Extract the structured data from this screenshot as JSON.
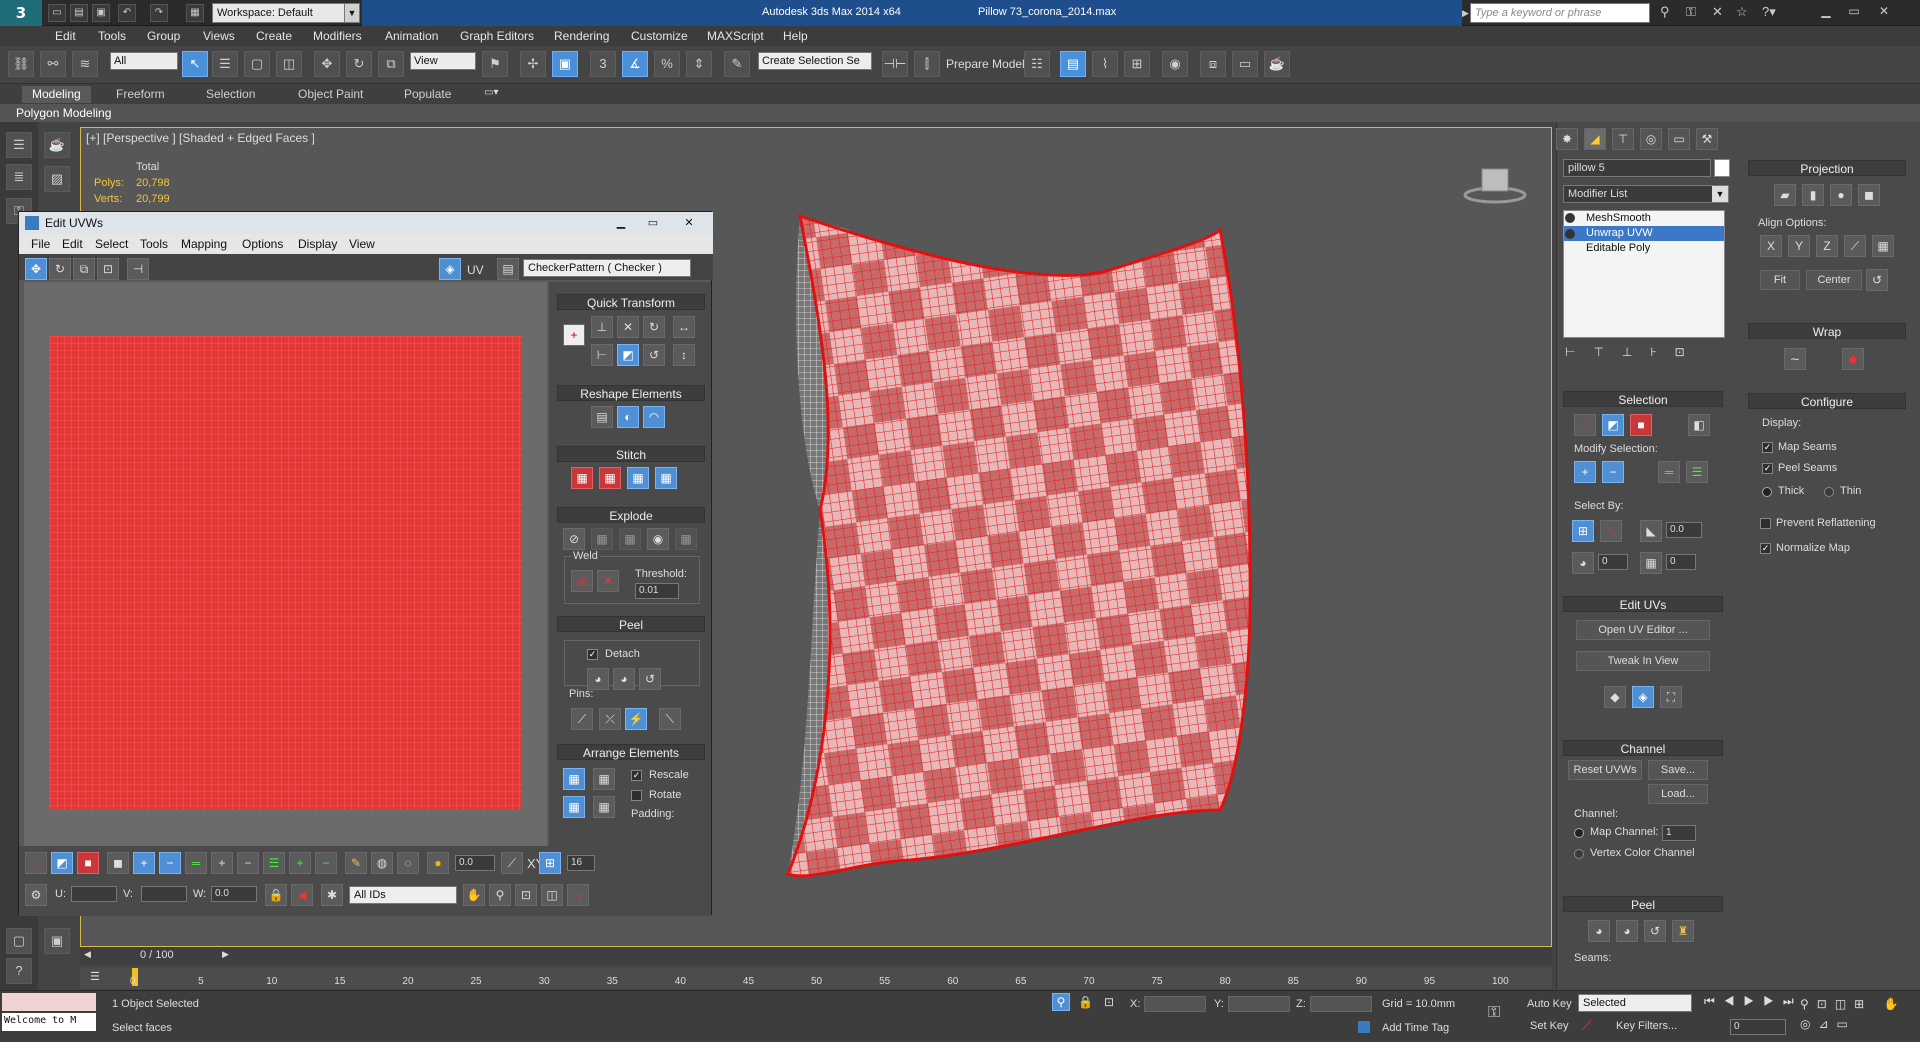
{
  "titlebar": {
    "workspace": "Workspace: Default",
    "app_title": "Autodesk 3ds Max  2014 x64",
    "file_title": "Pillow 73_corona_2014.max",
    "search_placeholder": "Type a keyword or phrase",
    "quick_access": [
      "new-icon",
      "open-icon",
      "save-icon",
      "undo-icon",
      "redo-icon",
      "project-folder-icon"
    ]
  },
  "menu": [
    "Edit",
    "Tools",
    "Group",
    "Views",
    "Create",
    "Modifiers",
    "Animation",
    "Graph Editors",
    "Rendering",
    "Customize",
    "MAXScript",
    "Help"
  ],
  "toolbar": {
    "selection_filter": "All",
    "ref_coord": "View",
    "named_selection": "Create Selection Se",
    "prepare_model": "Prepare Model",
    "snap_labels": {
      "snap3": "3",
      "angle": "",
      "percent": "%"
    }
  },
  "ribbon": {
    "tabs": [
      "Modeling",
      "Freeform",
      "Selection",
      "Object Paint",
      "Populate"
    ],
    "active_tab": "Modeling",
    "sub_label": "Polygon Modeling"
  },
  "viewport": {
    "label": "[+] [Perspective ] [Shaded + Edged Faces ]",
    "stats": {
      "total_label": "Total",
      "polys_label": "Polys:",
      "polys": "20,798",
      "verts_label": "Verts:",
      "verts": "20,799"
    }
  },
  "uvw_editor": {
    "title": "Edit UVWs",
    "menu": [
      "File",
      "Edit",
      "Select",
      "Tools",
      "Mapping",
      "Options",
      "Display",
      "View"
    ],
    "uv_label": "UV",
    "checker_select": "CheckerPattern  ( Checker )",
    "rollouts": {
      "quick_transform": "Quick Transform",
      "reshape": "Reshape Elements",
      "stitch": "Stitch",
      "explode": "Explode",
      "weld": "Weld",
      "threshold_label": "Threshold:",
      "threshold": "0.01",
      "peel": "Peel",
      "detach": "Detach",
      "pins": "Pins:",
      "arrange": "Arrange Elements",
      "rescale": "Rescale",
      "rotate": "Rotate",
      "padding": "Padding:"
    },
    "bottom": {
      "value_00": "0.0",
      "value_16": "16",
      "xy_label": "XY",
      "u_label": "U:",
      "v_label": "V:",
      "w_label": "W:",
      "w_value": "0.0",
      "ids_select": "All IDs"
    }
  },
  "command_panel": {
    "object_name": "pillow 5",
    "modifier_list": "Modifier List",
    "stack": [
      "MeshSmooth",
      "Unwrap UVW",
      "Editable Poly"
    ],
    "selected_index": 1,
    "selection": {
      "title": "Selection",
      "modify_selection": "Modify Selection:",
      "select_by": "Select By:",
      "angle": "0.0",
      "v1": "0",
      "v2": "0"
    },
    "edit_uvs": {
      "title": "Edit UVs",
      "open_editor": "Open UV Editor ...",
      "tweak": "Tweak In View"
    },
    "channel": {
      "title": "Channel",
      "reset": "Reset UVWs",
      "save": "Save...",
      "load": "Load...",
      "label": "Channel:",
      "map_channel": "Map Channel:",
      "map_value": "1",
      "vertex_color": "Vertex Color Channel"
    },
    "peel": {
      "title": "Peel",
      "seams": "Seams:"
    },
    "projection": {
      "title": "Projection",
      "align_options": "Align Options:",
      "x": "X",
      "y": "Y",
      "z": "Z",
      "fit": "Fit",
      "center": "Center"
    },
    "wrap": {
      "title": "Wrap"
    },
    "configure": {
      "title": "Configure",
      "display": "Display:",
      "map_seams": "Map Seams",
      "peel_seams": "Peel Seams",
      "thick": "Thick",
      "thin": "Thin",
      "prevent": "Prevent Reflattening",
      "normalize": "Normalize Map"
    }
  },
  "timeline": {
    "slider_label": "0 / 100",
    "ticks": [
      "0",
      "5",
      "10",
      "15",
      "20",
      "25",
      "30",
      "35",
      "40",
      "45",
      "50",
      "55",
      "60",
      "65",
      "70",
      "75",
      "80",
      "85",
      "90",
      "95",
      "100"
    ]
  },
  "statusbar": {
    "maxscript": "Welcome to M",
    "objects_selected": "1 Object Selected",
    "prompt": "Select faces",
    "x_label": "X:",
    "y_label": "Y:",
    "z_label": "Z:",
    "grid": "Grid = 10.0mm",
    "add_time_tag": "Add Time Tag",
    "auto_key": "Auto Key",
    "set_key": "Set Key",
    "selected": "Selected",
    "key_filters": "Key Filters...",
    "frame": "0"
  },
  "colors": {
    "accent": "#4a90d9",
    "uv_red": "#e23b3b",
    "title_blue": "#1e4e8c",
    "viewport_border": "#d6b94a"
  }
}
